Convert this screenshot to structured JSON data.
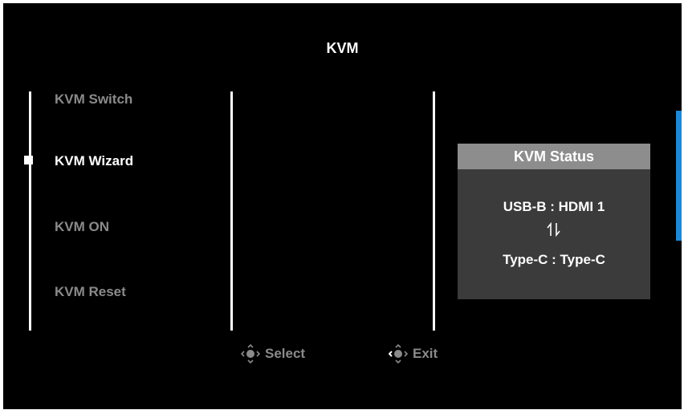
{
  "window": {
    "title": "KVM"
  },
  "menu": {
    "items": [
      {
        "label": "KVM Switch"
      },
      {
        "label": "KVM Wizard",
        "selected": true
      },
      {
        "label": "KVM ON"
      },
      {
        "label": "KVM Reset"
      }
    ]
  },
  "status": {
    "title": "KVM Status",
    "line1": "USB-B : HDMI 1",
    "swap_icon": "swap-vertical-arrows-icon",
    "line2": "Type-C : Type-C"
  },
  "hints": {
    "select": {
      "icon": "joystick-icon",
      "label": "Select"
    },
    "exit": {
      "icon": "joystick-left-icon",
      "label": "Exit"
    }
  },
  "colors": {
    "background": "#000000",
    "text_selected": "#ffffff",
    "text_dim": "#8a8a8a",
    "panel": "#3b3b3b",
    "panel_header": "#8d8d8d",
    "accent": "#1e88d6"
  }
}
